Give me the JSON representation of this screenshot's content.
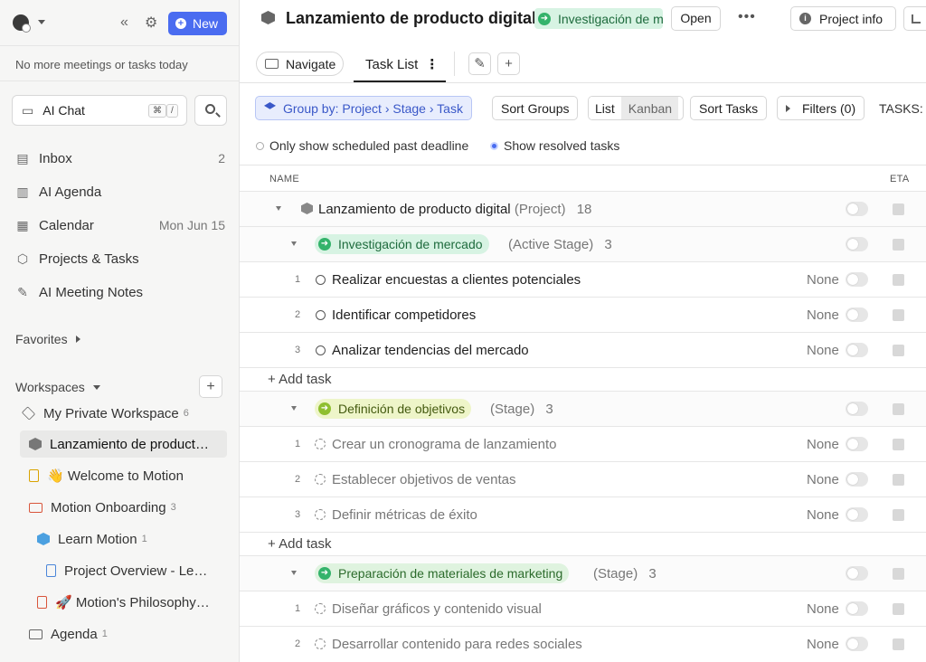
{
  "sidebar": {
    "new_label": "New",
    "status_text": "No more meetings or tasks today",
    "ai_chat_label": "AI Chat",
    "ai_chat_kbd1": "⌘",
    "ai_chat_kbd2": "/",
    "nav": [
      {
        "label": "Inbox",
        "right": "2",
        "icon": "inbox-icon"
      },
      {
        "label": "AI Agenda",
        "right": "",
        "icon": "agenda-icon"
      },
      {
        "label": "Calendar",
        "right": "Mon Jun 15",
        "icon": "calendar-icon"
      },
      {
        "label": "Projects & Tasks",
        "right": "",
        "icon": "cube-icon"
      },
      {
        "label": "AI Meeting Notes",
        "right": "",
        "icon": "notes-icon"
      }
    ],
    "favorites_label": "Favorites",
    "workspaces_label": "Workspaces",
    "tree": [
      {
        "label": "My Private Workspace",
        "count": "6",
        "icon": "layers-icon"
      },
      {
        "label": "Lanzamiento de product…",
        "count": "",
        "icon": "cube-icon"
      },
      {
        "label": "👋 Welcome to Motion",
        "count": "",
        "icon": "doc-icon"
      },
      {
        "label": "Motion Onboarding",
        "count": "3",
        "icon": "folder-icon"
      },
      {
        "label": "Learn Motion",
        "count": "1",
        "icon": "cube-icon"
      },
      {
        "label": "Project Overview - Le…",
        "count": "",
        "icon": "doc-icon"
      },
      {
        "label": "🚀 Motion's Philosophy…",
        "count": "",
        "icon": "doc-icon"
      },
      {
        "label": "Agenda",
        "count": "1",
        "icon": "folder-icon"
      }
    ]
  },
  "header": {
    "project_title": "Lanzamiento de producto digital",
    "stage_pill": "Investigación de mercado",
    "open_label": "Open",
    "more_label": "•••",
    "project_info_label": "Project info"
  },
  "tabs": {
    "navigate_label": "Navigate",
    "task_list_label": "Task List"
  },
  "toolbar": {
    "group_by": "Group by: Project › Stage › Task",
    "sort_groups": "Sort Groups",
    "view_list": "List",
    "view_kanban": "Kanban",
    "sort_tasks": "Sort Tasks",
    "filters": "Filters (0)",
    "tasks_label": "TASKS:",
    "opt_scheduled": "Only show scheduled past deadline",
    "opt_resolved": "Show resolved tasks"
  },
  "table": {
    "col_name": "NAME",
    "col_eta": "ETA",
    "project_name": "Lanzamiento de producto digital",
    "project_tag": "(Project)",
    "project_count": "18",
    "add_task_label": "+ Add task",
    "groups": [
      {
        "name": "Investigación de mercado",
        "tag": "(Active Stage)",
        "count": "3",
        "tasks": [
          {
            "num": "1",
            "name": "Realizar encuestas a clientes potenciales",
            "eta": "None"
          },
          {
            "num": "2",
            "name": "Identificar competidores",
            "eta": "None"
          },
          {
            "num": "3",
            "name": "Analizar tendencias del mercado",
            "eta": "None"
          }
        ]
      },
      {
        "name": "Definición de objetivos",
        "tag": "(Stage)",
        "count": "3",
        "tasks": [
          {
            "num": "1",
            "name": "Crear un cronograma de lanzamiento",
            "eta": "None"
          },
          {
            "num": "2",
            "name": "Establecer objetivos de ventas",
            "eta": "None"
          },
          {
            "num": "3",
            "name": "Definir métricas de éxito",
            "eta": "None"
          }
        ]
      },
      {
        "name": "Preparación de materiales de marketing",
        "tag": "(Stage)",
        "count": "3",
        "tasks": [
          {
            "num": "1",
            "name": "Diseñar gráficos y contenido visual",
            "eta": "None"
          },
          {
            "num": "2",
            "name": "Desarrollar contenido para redes sociales",
            "eta": "None"
          }
        ]
      }
    ]
  }
}
